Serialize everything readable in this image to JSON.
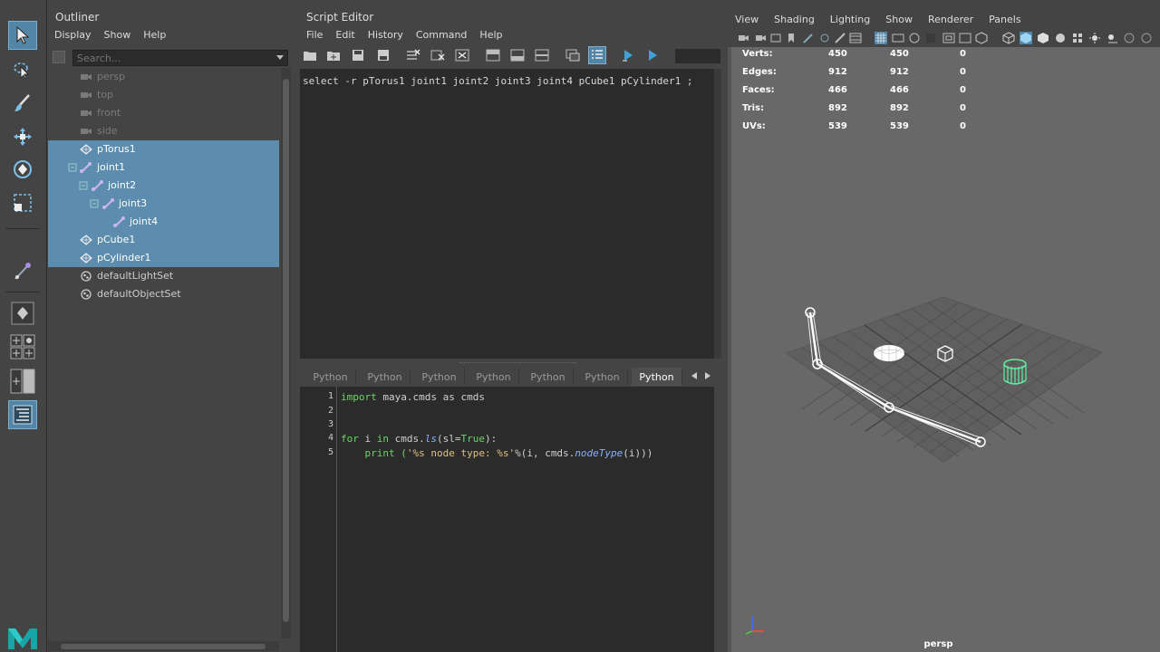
{
  "outliner": {
    "title": "Outliner",
    "menu": [
      "Display",
      "Show",
      "Help"
    ],
    "search_placeholder": "Search...",
    "items": [
      {
        "label": "persp",
        "type": "camera",
        "dim": true,
        "indent": 0
      },
      {
        "label": "top",
        "type": "camera",
        "dim": true,
        "indent": 0
      },
      {
        "label": "front",
        "type": "camera",
        "dim": true,
        "indent": 0
      },
      {
        "label": "side",
        "type": "camera",
        "dim": true,
        "indent": 0
      },
      {
        "label": "pTorus1",
        "type": "mesh",
        "selected": true,
        "indent": 0
      },
      {
        "label": "joint1",
        "type": "joint",
        "selected": true,
        "indent": 0
      },
      {
        "label": "joint2",
        "type": "joint",
        "selected": true,
        "indent": 1
      },
      {
        "label": "joint3",
        "type": "joint",
        "selected": true,
        "indent": 2
      },
      {
        "label": "joint4",
        "type": "joint",
        "selected": true,
        "indent": 3
      },
      {
        "label": "pCube1",
        "type": "mesh",
        "selected": true,
        "indent": 0
      },
      {
        "label": "pCylinder1",
        "type": "mesh",
        "selected": true,
        "indent": 0
      },
      {
        "label": "defaultLightSet",
        "type": "set",
        "indent": 0
      },
      {
        "label": "defaultObjectSet",
        "type": "set",
        "indent": 0
      }
    ]
  },
  "script_editor": {
    "title": "Script Editor",
    "menu": [
      "File",
      "Edit",
      "History",
      "Command",
      "Help"
    ],
    "history_line": "select -r pTorus1 joint1 joint2 joint3 joint4 pCube1 pCylinder1 ;",
    "tabs": [
      "Python",
      "Python",
      "Python",
      "Python",
      "Python",
      "Python",
      "Python"
    ],
    "active_tab_index": 6,
    "line_numbers": [
      "1",
      "2",
      "3",
      "4",
      "5"
    ],
    "code": {
      "l1_kw": "import",
      "l1_rest": " maya.cmds as cmds",
      "l4_kw1": "for",
      "l4_a": " i ",
      "l4_kw2": "in",
      "l4_b": " cmds.",
      "l4_fn": "ls",
      "l4_c": "(sl=",
      "l4_kw3": "True",
      "l4_d": "):",
      "l5_a": "    print (",
      "l5_str": "'%s node type: %s'",
      "l5_b": "%(i, cmds.",
      "l5_fn": "nodeType",
      "l5_c": "(i)))"
    }
  },
  "viewport": {
    "menu": [
      "View",
      "Shading",
      "Lighting",
      "Show",
      "Renderer",
      "Panels"
    ],
    "hud": [
      {
        "label": "Verts:",
        "a": "450",
        "b": "450",
        "c": "0"
      },
      {
        "label": "Edges:",
        "a": "912",
        "b": "912",
        "c": "0"
      },
      {
        "label": "Faces:",
        "a": "466",
        "b": "466",
        "c": "0"
      },
      {
        "label": "Tris:",
        "a": "892",
        "b": "892",
        "c": "0"
      },
      {
        "label": "UVs:",
        "a": "539",
        "b": "539",
        "c": "0"
      }
    ],
    "camera": "persp"
  },
  "colors": {
    "selection": "#5d8dae",
    "accent": "#5285a6",
    "wire_selected": "#5ef0a0",
    "panel_bg": "#444444",
    "viewport_bg": "#686868"
  }
}
